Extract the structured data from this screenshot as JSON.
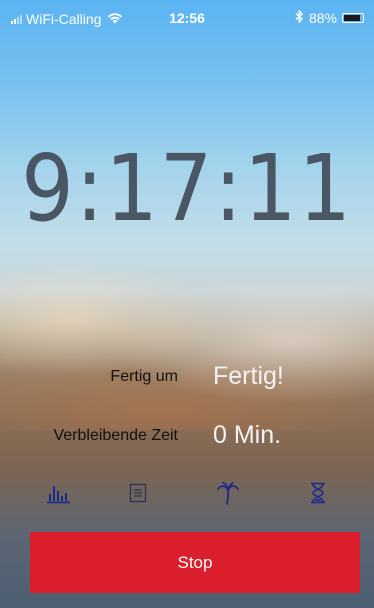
{
  "status_bar": {
    "carrier": "WiFi-Calling",
    "time": "12:56",
    "battery": "88%",
    "battery_level": 0.88,
    "icons": [
      "signal-icon",
      "wifi-icon",
      "bluetooth-icon",
      "battery-icon"
    ]
  },
  "timer": {
    "display": "9:17:11"
  },
  "info": {
    "finish_label": "Fertig um",
    "finish_value": "Fertig!",
    "remaining_label": "Verbleibende Zeit",
    "remaining_value": "0 Min."
  },
  "toolbar": {
    "items": [
      "stats-chart-icon",
      "notes-icon",
      "palm-tree-icon",
      "hourglass-icon"
    ],
    "icon_color": "#1e2a8a"
  },
  "actions": {
    "stop_label": "Stop",
    "stop_color": "#db1e2b"
  }
}
